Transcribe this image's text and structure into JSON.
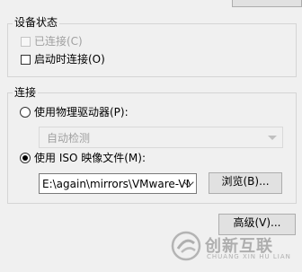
{
  "device_status": {
    "title": "设备状态",
    "connected_label": "已连接(C)",
    "connect_at_power_on_label": "启动时连接(O)"
  },
  "connection": {
    "title": "连接",
    "physical_drive_label": "使用物理驱动器(P):",
    "physical_drive_value": "自动检测",
    "iso_label": "使用 ISO 映像文件(M):",
    "iso_path": "E:\\again\\mirrors\\VMware-VM",
    "browse_label": "浏览(B)..."
  },
  "advanced_label": "高级(V)...",
  "watermark": {
    "text": "创新互联",
    "sub": "CHUANG XIN HU LIAN"
  }
}
